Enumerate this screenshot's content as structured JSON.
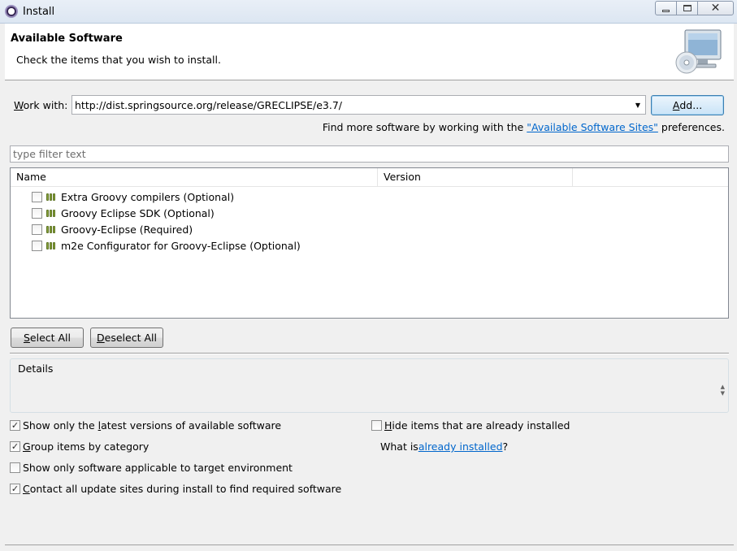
{
  "window": {
    "title": "Install",
    "minimize": "▭",
    "maximize": "□",
    "close": "✕"
  },
  "banner": {
    "title": "Available Software",
    "description": "Check the items that you wish to install."
  },
  "work_with": {
    "label_first": "W",
    "label_rest": "ork with:",
    "value": "http://dist.springsource.org/release/GRECLIPSE/e3.7/",
    "add_label_first": "A",
    "add_label_rest": "dd...",
    "find_more_prefix": "Find more software by working with the ",
    "find_more_link": "\"Available Software Sites\"",
    "find_more_suffix": " preferences."
  },
  "filter": {
    "placeholder": "type filter text"
  },
  "tree": {
    "columns": [
      "Name",
      "Version"
    ],
    "items": [
      {
        "label": "Extra Groovy compilers (Optional)",
        "checked": false
      },
      {
        "label": "Groovy Eclipse SDK (Optional)",
        "checked": false
      },
      {
        "label": "Groovy-Eclipse (Required)",
        "checked": false
      },
      {
        "label": "m2e Configurator for Groovy-Eclipse (Optional)",
        "checked": false
      }
    ]
  },
  "buttons": {
    "select_all_first": "S",
    "select_all_rest": "elect All",
    "deselect_all_first": "D",
    "deselect_all_rest": "eselect All"
  },
  "details": {
    "label": "Details"
  },
  "options": {
    "latest_pre": "Show only the ",
    "latest_key": "l",
    "latest_post": "atest versions of available software",
    "latest_checked": true,
    "group_key": "G",
    "group_post": "roup items by category",
    "group_checked": true,
    "target": "Show only software applicable to target environment",
    "target_checked": false,
    "contact_key": "C",
    "contact_post": "ontact all update sites during install to find required software",
    "contact_checked": true,
    "hide_key": "H",
    "hide_post": "ide items that are already installed",
    "hide_checked": false,
    "whatis_prefix": "What is ",
    "whatis_link": "already installed",
    "whatis_suffix": "?"
  },
  "colors": {
    "link": "#0066cc",
    "banner_bg": "#ffffff",
    "dialog_bg": "#f0f0f0"
  },
  "icons": {
    "check": "✓",
    "combo_arrow": "▼",
    "scroll_up": "▲",
    "scroll_down": "▼"
  }
}
